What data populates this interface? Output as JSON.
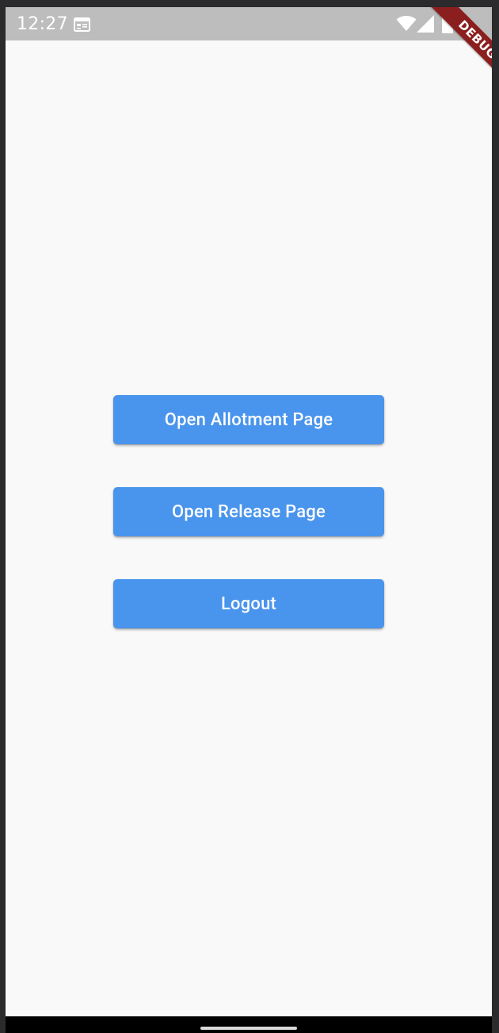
{
  "status_bar": {
    "time": "12:27",
    "icons": [
      "calendar-icon",
      "wifi-icon",
      "cell-signal-icon",
      "battery-icon"
    ]
  },
  "debug_banner": {
    "label": "DEBUG",
    "color": "#8b1e1e"
  },
  "main": {
    "buttons": [
      {
        "label": "Open Allotment Page"
      },
      {
        "label": "Open Release Page"
      },
      {
        "label": "Logout"
      }
    ]
  },
  "theme": {
    "button_color": "#4994ec",
    "background": "#f9f9f9",
    "status_bar_color": "#bdbdbd"
  }
}
